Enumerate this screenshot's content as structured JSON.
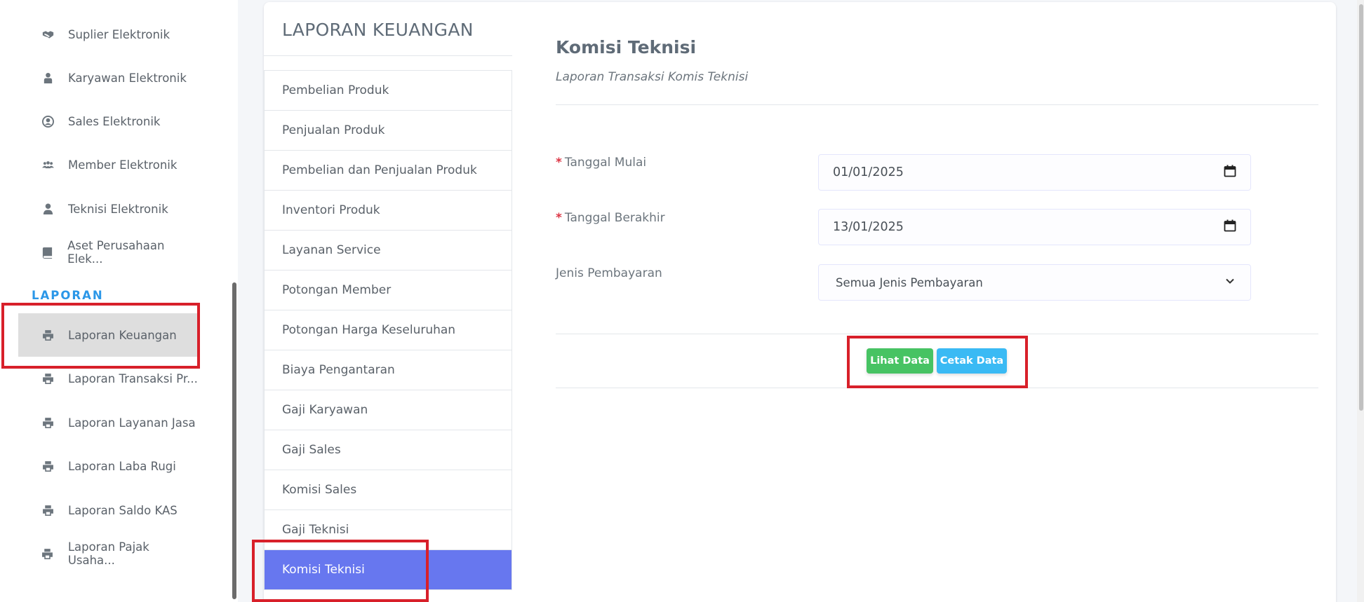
{
  "sidebar": {
    "items": [
      {
        "label": "Suplier Elektronik",
        "icon": "handshake-icon"
      },
      {
        "label": "Karyawan Elektronik",
        "icon": "user-tie-icon"
      },
      {
        "label": "Sales Elektronik",
        "icon": "user-circle-icon"
      },
      {
        "label": "Member Elektronik",
        "icon": "users-icon"
      },
      {
        "label": "Teknisi Elektronik",
        "icon": "user-icon"
      },
      {
        "label": "Aset Perusahaan Elek...",
        "icon": "book-icon"
      }
    ],
    "section": "LAPORAN",
    "report_items": [
      {
        "label": "Laporan Keuangan",
        "icon": "print-icon"
      },
      {
        "label": "Laporan Transaksi Pr...",
        "icon": "print-icon"
      },
      {
        "label": "Laporan Layanan Jasa",
        "icon": "print-icon"
      },
      {
        "label": "Laporan Laba Rugi",
        "icon": "print-icon"
      },
      {
        "label": "Laporan Saldo KAS",
        "icon": "print-icon"
      },
      {
        "label": "Laporan Pajak Usaha...",
        "icon": "print-icon"
      }
    ]
  },
  "menu": {
    "title": "LAPORAN KEUANGAN",
    "items": [
      "Pembelian Produk",
      "Penjualan Produk",
      "Pembelian dan Penjualan Produk",
      "Inventori Produk",
      "Layanan Service",
      "Potongan Member",
      "Potongan Harga Keseluruhan",
      "Biaya Pengantaran",
      "Gaji Karyawan",
      "Gaji Sales",
      "Komisi Sales",
      "Gaji Teknisi",
      "Komisi Teknisi"
    ],
    "active": "Komisi Teknisi"
  },
  "content": {
    "title": "Komisi Teknisi",
    "subtitle": "Laporan Transaksi Komis Teknisi",
    "form": {
      "start_label": "Tanggal Mulai",
      "start_value": "01/01/2025",
      "end_label": "Tanggal Berakhir",
      "end_value": "13/01/2025",
      "payment_label": "Jenis Pembayaran",
      "payment_value": "Semua Jenis Pembayaran",
      "required_mark": "*"
    },
    "buttons": {
      "view": "Lihat Data",
      "print": "Cetak Data"
    }
  },
  "colors": {
    "accent": "#6777ef",
    "section": "#2b97e8",
    "green": "#47c363",
    "blue": "#3abaf4",
    "highlight": "#d8202a"
  }
}
